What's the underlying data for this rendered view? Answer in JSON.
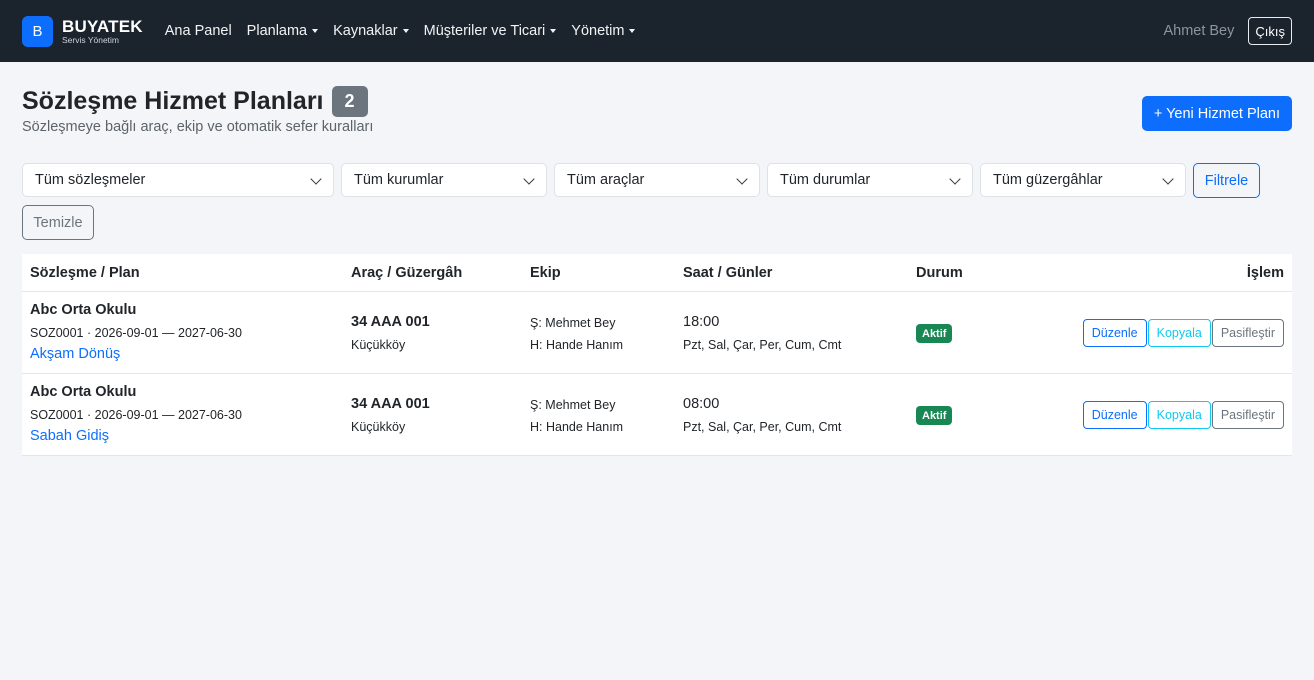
{
  "nav": {
    "logo_letter": "B",
    "brand": "BUYATEK",
    "brand_sub": "Servis Yönetim",
    "items": [
      "Ana Panel",
      "Planlama",
      "Kaynaklar",
      "Müşteriler ve Ticari",
      "Yönetim"
    ],
    "user": "Ahmet Bey",
    "logout": "Çıkış"
  },
  "header": {
    "title": "Sözleşme Hizmet Planları",
    "count": "2",
    "subtitle": "Sözleşmeye bağlı araç, ekip ve otomatik sefer kuralları",
    "new_button": "+ Yeni Hizmet Planı"
  },
  "filters": {
    "contracts": "Tüm sözleşmeler",
    "institutions": "Tüm kurumlar",
    "vehicles": "Tüm araçlar",
    "statuses": "Tüm durumlar",
    "routes": "Tüm güzergâhlar",
    "filter_button": "Filtrele",
    "clear_button": "Temizle"
  },
  "table": {
    "headers": [
      "Sözleşme / Plan",
      "Araç / Güzergâh",
      "Ekip",
      "Saat / Günler",
      "Durum",
      "İşlem"
    ],
    "rows": [
      {
        "school": "Abc Orta Okulu",
        "contract": "SOZ0001 · 2026-09-01 — 2027-06-30",
        "plan": "Akşam Dönüş",
        "plate": "34 AAA 001",
        "route": "Küçükköy",
        "driver": "Ş: Mehmet Bey",
        "hostess": "H: Hande Hanım",
        "time": "18:00",
        "days": "Pzt, Sal, Çar, Per, Cum, Cmt",
        "status": "Aktif",
        "edit": "Düzenle",
        "copy": "Kopyala",
        "deactivate": "Pasifleştir"
      },
      {
        "school": "Abc Orta Okulu",
        "contract": "SOZ0001 · 2026-09-01 — 2027-06-30",
        "plan": "Sabah Gidiş",
        "plate": "34 AAA 001",
        "route": "Küçükköy",
        "driver": "Ş: Mehmet Bey",
        "hostess": "H: Hande Hanım",
        "time": "08:00",
        "days": "Pzt, Sal, Çar, Per, Cum, Cmt",
        "status": "Aktif",
        "edit": "Düzenle",
        "copy": "Kopyala",
        "deactivate": "Pasifleştir"
      }
    ]
  }
}
